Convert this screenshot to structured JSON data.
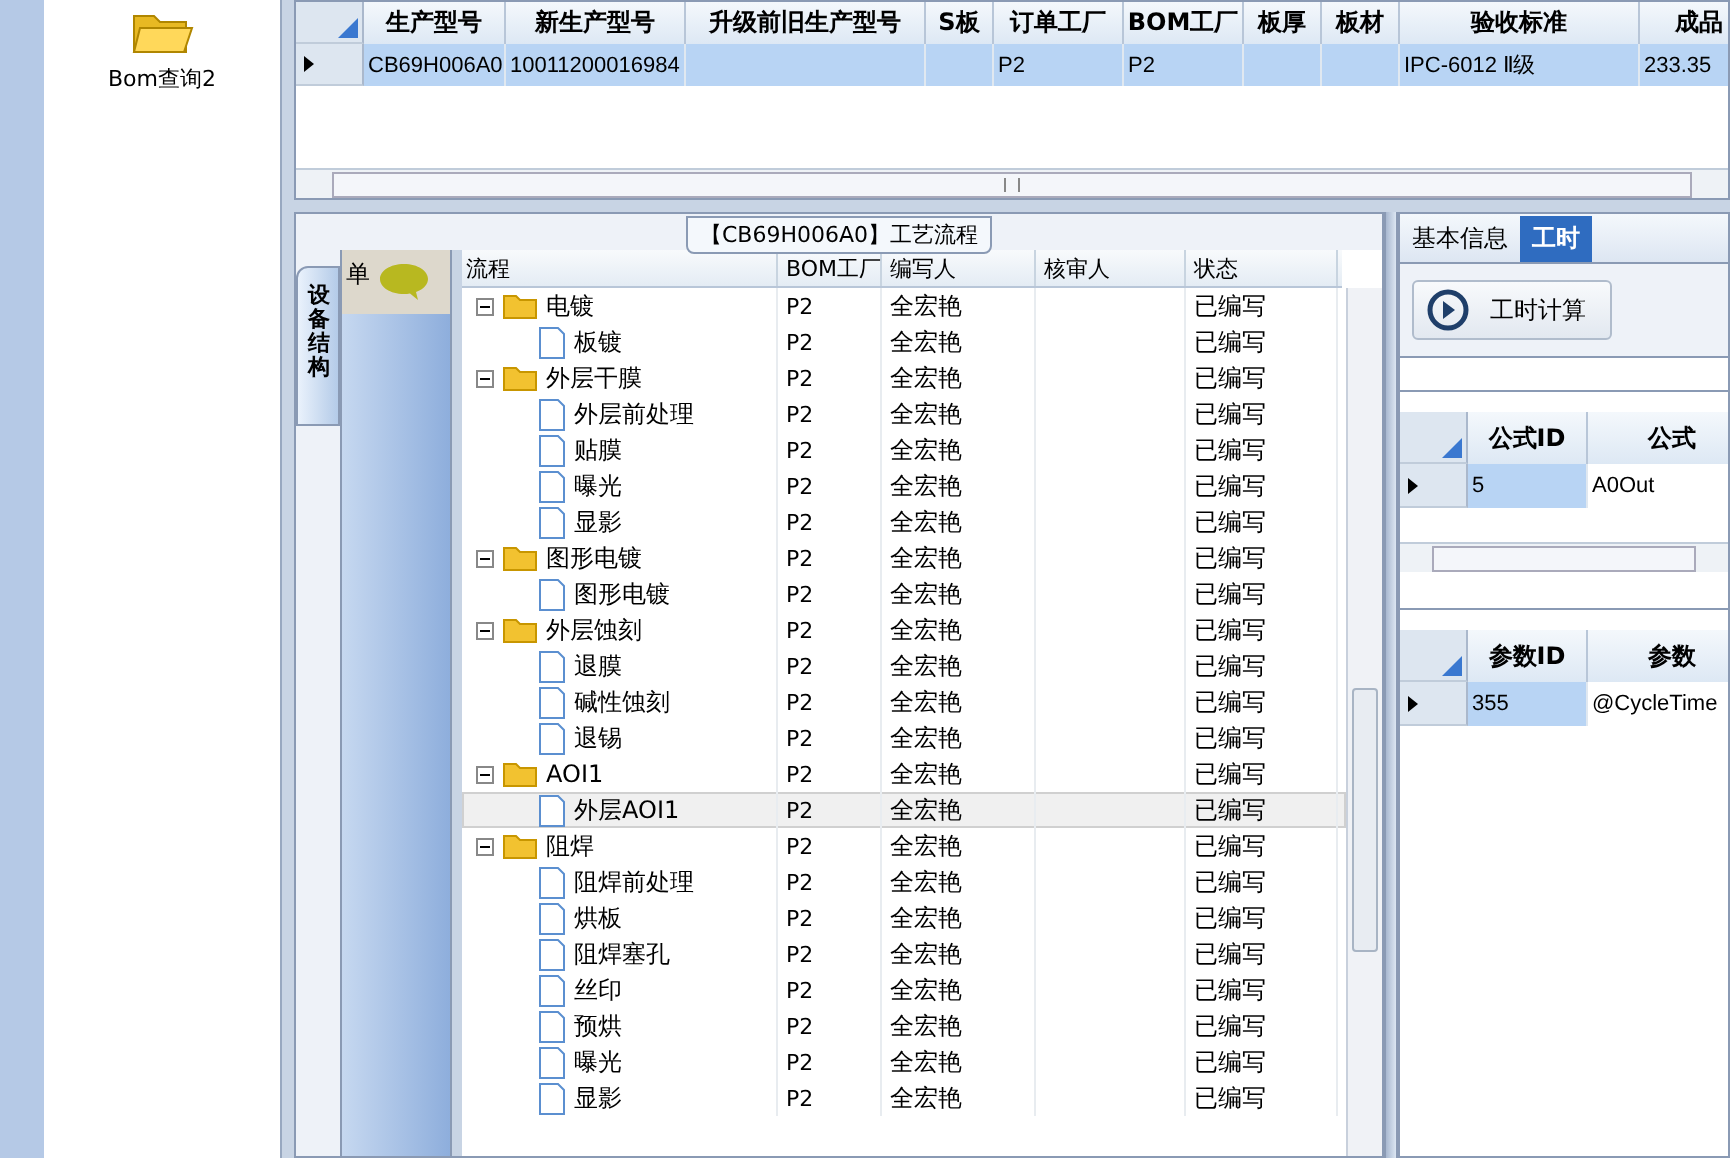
{
  "sidebar": {
    "items": [
      {
        "label": "Bom查询2"
      }
    ]
  },
  "order_grid": {
    "columns": [
      "生产型号",
      "新生产型号",
      "升级前旧生产型号",
      "S板",
      "订单工厂",
      "BOM工厂",
      "板厚",
      "板材",
      "验收标准",
      "成品"
    ],
    "rows": [
      {
        "selected": true,
        "cells": [
          "CB69H006A0",
          "10011200016984",
          "",
          "",
          "P2",
          "P2",
          "",
          "",
          "IPC-6012 Ⅱ级",
          "233.35"
        ]
      }
    ]
  },
  "process": {
    "caption": "【CB69H006A0】工艺流程",
    "side_tab": "设备结构",
    "side_panel_label": "单",
    "columns": [
      "流程",
      "BOM工厂",
      "编写人",
      "核审人",
      "状态"
    ],
    "tree": [
      {
        "label": "电镀",
        "kind": "folder",
        "expanded": true,
        "bom": "P2",
        "writer": "全宏艳",
        "status": "已编写",
        "selected": false,
        "children": [
          {
            "label": "板镀",
            "kind": "step",
            "bom": "P2",
            "writer": "全宏艳",
            "status": "已编写",
            "selected": false
          }
        ]
      },
      {
        "label": "外层干膜",
        "kind": "folder",
        "expanded": true,
        "bom": "P2",
        "writer": "全宏艳",
        "status": "已编写",
        "selected": false,
        "children": [
          {
            "label": "外层前处理",
            "kind": "step",
            "bom": "P2",
            "writer": "全宏艳",
            "status": "已编写",
            "selected": false
          },
          {
            "label": "贴膜",
            "kind": "step",
            "bom": "P2",
            "writer": "全宏艳",
            "status": "已编写",
            "selected": false
          },
          {
            "label": "曝光",
            "kind": "step",
            "bom": "P2",
            "writer": "全宏艳",
            "status": "已编写",
            "selected": false
          },
          {
            "label": "显影",
            "kind": "step",
            "bom": "P2",
            "writer": "全宏艳",
            "status": "已编写",
            "selected": false
          }
        ]
      },
      {
        "label": "图形电镀",
        "kind": "folder",
        "expanded": true,
        "bom": "P2",
        "writer": "全宏艳",
        "status": "已编写",
        "selected": false,
        "children": [
          {
            "label": "图形电镀",
            "kind": "step",
            "bom": "P2",
            "writer": "全宏艳",
            "status": "已编写",
            "selected": false
          }
        ]
      },
      {
        "label": "外层蚀刻",
        "kind": "folder",
        "expanded": true,
        "bom": "P2",
        "writer": "全宏艳",
        "status": "已编写",
        "selected": false,
        "children": [
          {
            "label": "退膜",
            "kind": "step",
            "bom": "P2",
            "writer": "全宏艳",
            "status": "已编写",
            "selected": false
          },
          {
            "label": "碱性蚀刻",
            "kind": "step",
            "bom": "P2",
            "writer": "全宏艳",
            "status": "已编写",
            "selected": false
          },
          {
            "label": "退锡",
            "kind": "step",
            "bom": "P2",
            "writer": "全宏艳",
            "status": "已编写",
            "selected": false
          }
        ]
      },
      {
        "label": "AOI1",
        "kind": "folder",
        "expanded": true,
        "bom": "P2",
        "writer": "全宏艳",
        "status": "已编写",
        "selected": false,
        "children": [
          {
            "label": "外层AOI1",
            "kind": "step",
            "bom": "P2",
            "writer": "全宏艳",
            "status": "已编写",
            "selected": true
          }
        ]
      },
      {
        "label": "阻焊",
        "kind": "folder",
        "expanded": true,
        "bom": "P2",
        "writer": "全宏艳",
        "status": "已编写",
        "selected": false,
        "children": [
          {
            "label": "阻焊前处理",
            "kind": "step",
            "bom": "P2",
            "writer": "全宏艳",
            "status": "已编写",
            "selected": false
          },
          {
            "label": "烘板",
            "kind": "step",
            "bom": "P2",
            "writer": "全宏艳",
            "status": "已编写",
            "selected": false
          },
          {
            "label": "阻焊塞孔",
            "kind": "step",
            "bom": "P2",
            "writer": "全宏艳",
            "status": "已编写",
            "selected": false
          },
          {
            "label": "丝印",
            "kind": "step",
            "bom": "P2",
            "writer": "全宏艳",
            "status": "已编写",
            "selected": false
          },
          {
            "label": "预烘",
            "kind": "step",
            "bom": "P2",
            "writer": "全宏艳",
            "status": "已编写",
            "selected": false
          },
          {
            "label": "曝光",
            "kind": "step",
            "bom": "P2",
            "writer": "全宏艳",
            "status": "已编写",
            "selected": false
          },
          {
            "label": "显影",
            "kind": "step",
            "bom": "P2",
            "writer": "全宏艳",
            "status": "已编写",
            "selected": false
          }
        ]
      }
    ]
  },
  "detail": {
    "tabs": [
      {
        "label": "基本信息",
        "selected": false
      },
      {
        "label": "工时",
        "selected": true
      }
    ],
    "calc_button": "工时计算",
    "formula_grid": {
      "columns": [
        "公式ID",
        "公式"
      ],
      "rows": [
        {
          "selected": true,
          "cells": [
            "5",
            "A0Out"
          ]
        }
      ]
    },
    "param_grid": {
      "columns": [
        "参数ID",
        "参数"
      ],
      "rows": [
        {
          "selected": true,
          "cells": [
            "355",
            "@CycleTime"
          ]
        }
      ]
    }
  }
}
